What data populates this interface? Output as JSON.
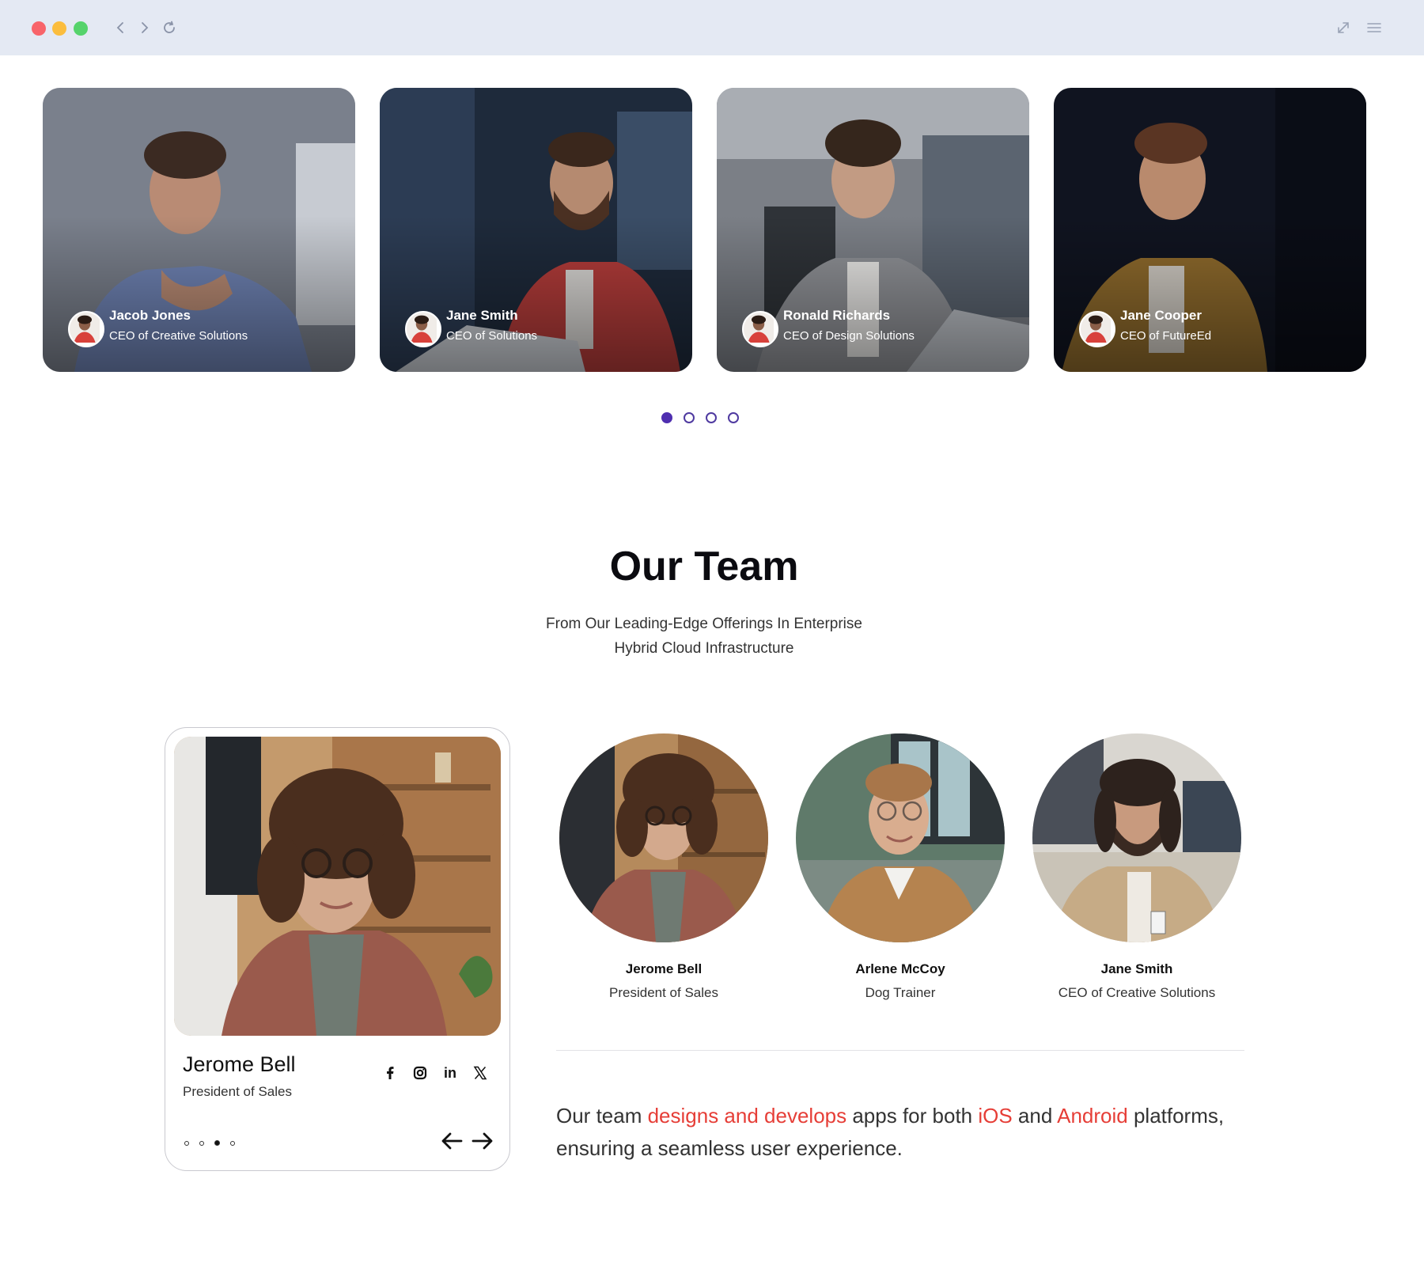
{
  "browser": {
    "icons": [
      "chevron-left-icon",
      "chevron-right-icon",
      "reload-icon",
      "expand-icon",
      "menu-icon"
    ]
  },
  "carousel": {
    "cards": [
      {
        "name": "Jacob Jones",
        "role": "CEO of Creative Solutions"
      },
      {
        "name": "Jane Smith",
        "role": "CEO of Solutions"
      },
      {
        "name": "Ronald Richards",
        "role": "CEO of Design Solutions"
      },
      {
        "name": "Jane Cooper",
        "role": "CEO of FutureEd"
      }
    ],
    "active_page": 1,
    "page_count": 4
  },
  "team": {
    "title": "Our Team",
    "subtitle_line1": "From Our Leading-Edge Offerings In Enterprise",
    "subtitle_line2": "Hybrid Cloud Infrastructure"
  },
  "profile_card": {
    "name": "Jerome Bell",
    "role": "President of Sales",
    "socials": [
      "facebook-icon",
      "instagram-icon",
      "linkedin-icon",
      "x-icon"
    ],
    "linkedin_text": "in",
    "active_dot": 3,
    "dot_count": 4
  },
  "members": [
    {
      "name": "Jerome Bell",
      "role": "President of Sales"
    },
    {
      "name": "Arlene McCoy",
      "role": "Dog Trainer"
    },
    {
      "name": "Jane Smith",
      "role": "CEO of Creative Solutions"
    }
  ],
  "tagline": {
    "part1": "Our team ",
    "hl1": "designs and develops",
    "part2": " apps for both ",
    "hl2": "iOS",
    "part3": " and ",
    "hl3": "Android",
    "part4": " platforms, ensuring a seamless user experience."
  },
  "colors": {
    "accent_purple": "#4f2fb0",
    "highlight_red": "#e63e37",
    "chrome_bg": "#e4e9f3"
  }
}
